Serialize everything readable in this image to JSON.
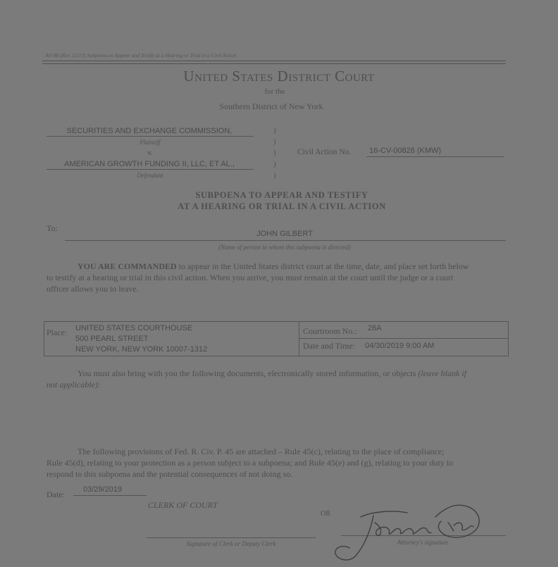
{
  "form_ref": "AO 88 (Rev. 12/13) Subpoena to Appear and Testify at a Hearing or Trial in a Civil Action",
  "court": {
    "title": "United States District Court",
    "for_the": "for the",
    "district": "Southern District of New York"
  },
  "caption": {
    "plaintiff": "SECURITIES AND EXCHANGE COMMISSION,",
    "plaintiff_label": "Plaintiff",
    "versus": "v.",
    "defendant": "AMERICAN GROWTH FUNDING II, LLC, ET AL.,",
    "defendant_label": "Defendant",
    "civil_action_label": "Civil Action No.",
    "civil_action_no": "16-CV-00828 (KMW)"
  },
  "heading": {
    "line1": "SUBPOENA TO APPEAR AND TESTIFY",
    "line2": "AT A HEARING OR TRIAL IN A CIVIL ACTION"
  },
  "to": {
    "label": "To:",
    "name": "JOHN GILBERT",
    "caption": "(Name of person to whom this subpoena is directed)"
  },
  "command": {
    "lead": "YOU ARE COMMANDED",
    "line1_rest": " to appear in the United States district court at the time, date, and place set forth below",
    "line2": "to testify at a hearing or trial in this civil action.  When you arrive, you must remain at the court until the judge or a court",
    "line3": "officer allows you to leave."
  },
  "place": {
    "label": "Place:",
    "line1": "UNITED STATES COURTHOUSE",
    "line2": "500 PEARL STREET",
    "line3": "NEW YORK, NEW YORK 10007-1312",
    "courtroom_label": "Courtroom No.:",
    "courtroom": "26A",
    "datetime_label": "Date and Time:",
    "datetime": "04/30/2019 9:00 AM"
  },
  "documents": {
    "line1": "You must also bring with you the following documents, electronically stored information, or objects",
    "hint1": "(leave blank if",
    "hint2": "not applicable):"
  },
  "provisions": {
    "line1": "The following provisions of Fed. R. Civ. P. 45 are attached – Rule 45(c), relating to the place of compliance;",
    "line2": "Rule 45(d), relating to your protection as a person subject to a subpoena; and Rule 45(e) and (g), relating to your duty to",
    "line3": "respond to this subpoena and the potential consequences of not doing so."
  },
  "date": {
    "label": "Date:",
    "value": "03/29/2019"
  },
  "clerk": {
    "label": "CLERK OF COURT",
    "or": "OR",
    "sig_caption": "Signature of Clerk or Deputy Clerk",
    "attorney_caption": "Attorney's signature"
  }
}
